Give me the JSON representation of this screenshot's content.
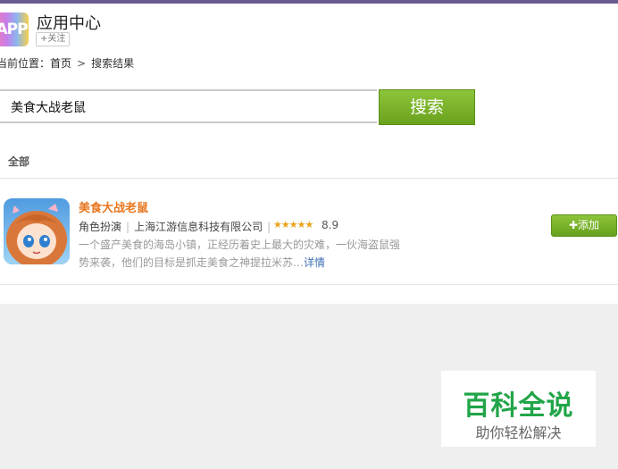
{
  "header": {
    "logo_text": "APP",
    "title": "应用中心",
    "follow_label": "+关注"
  },
  "breadcrumb": {
    "prefix": "当前位置：",
    "home": "首页",
    "separator": ">",
    "current": "搜索结果"
  },
  "search": {
    "value": "美食大战老鼠",
    "button_label": "搜索"
  },
  "tabs": {
    "all_label": "全部"
  },
  "results": [
    {
      "name": "美食大战老鼠",
      "category": "角色扮演",
      "developer": "上海江游信息科技有限公司",
      "rating_stars": "★★★★★",
      "score": "8.9",
      "description": "一个盛产美食的海岛小镇，正经历着史上最大的灾难，一伙海盗鼠强势来袭，他们的目标是抓走美食之神提拉米苏…",
      "more_label": "详情",
      "add_label": "✚添加"
    }
  ],
  "watermark": {
    "title": "百科全说",
    "subtitle": "助你轻松解决"
  }
}
